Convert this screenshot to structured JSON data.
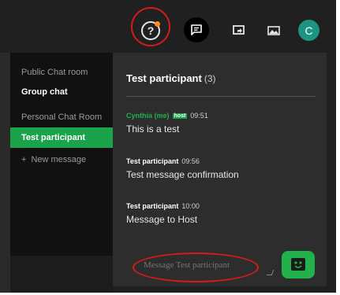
{
  "topbar": {
    "icons": [
      "help-icon",
      "chat-icon",
      "share-screen-icon",
      "gallery-icon"
    ],
    "avatar_letter": "C",
    "accent_color": "#1aa34a",
    "notification_color": "#ff8a1f"
  },
  "sidebar": {
    "items": [
      {
        "label": "Public Chat room",
        "style": "muted"
      },
      {
        "label": "Group chat",
        "style": "bold"
      },
      {
        "label": "Personal Chat Room",
        "style": "muted"
      },
      {
        "label": "Test participant",
        "style": "active"
      },
      {
        "label": "New message",
        "style": "muted"
      }
    ]
  },
  "chat": {
    "title": "Test participant",
    "count": "(3)",
    "messages": [
      {
        "author": "Cynthia (me)",
        "badge": "host",
        "time": "09:51",
        "text": "This is a test"
      },
      {
        "author": "Test participant",
        "time": "09:56",
        "text": "Test message confirmation"
      },
      {
        "author": "Test participant",
        "time": "10:00",
        "text": "Message to Host"
      }
    ]
  },
  "compose": {
    "placeholder": "Message Test participant"
  }
}
